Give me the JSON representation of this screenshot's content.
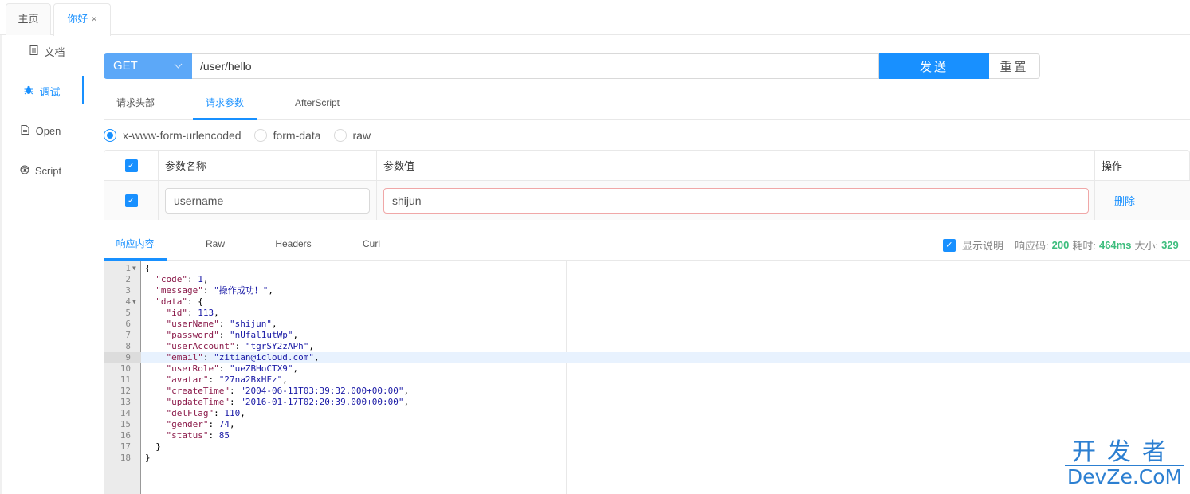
{
  "top_tabs": [
    {
      "label": "主页"
    },
    {
      "label": "你好",
      "close_icon": "×"
    }
  ],
  "left_nav": [
    {
      "label": "文档",
      "icon": "document-icon"
    },
    {
      "label": "调试",
      "icon": "bug-icon",
      "active": true
    },
    {
      "label": "Open",
      "icon": "file-icon"
    },
    {
      "label": "Script",
      "icon": "script-icon"
    }
  ],
  "url_bar": {
    "method": "GET",
    "url": "/user/hello",
    "send_label": "发送",
    "reset_label": "重置"
  },
  "request_tabs": [
    {
      "label": "请求头部"
    },
    {
      "label": "请求参数",
      "active": true
    },
    {
      "label": "AfterScript"
    }
  ],
  "body_types": [
    {
      "label": "x-www-form-urlencoded",
      "checked": true
    },
    {
      "label": "form-data"
    },
    {
      "label": "raw"
    }
  ],
  "params_table": {
    "headers": {
      "name": "参数名称",
      "value": "参数值",
      "op": "操作"
    },
    "rows": [
      {
        "checked": true,
        "name": "username",
        "value": "shijun",
        "action": "删除"
      }
    ]
  },
  "response_tabs": [
    {
      "label": "响应内容",
      "active": true
    },
    {
      "label": "Raw"
    },
    {
      "label": "Headers"
    },
    {
      "label": "Curl"
    }
  ],
  "response_info": {
    "show_desc_label": "显示说明",
    "show_desc_checked": true,
    "code_label": "响应码:",
    "code": "200",
    "time_label": "耗时:",
    "time": "464ms",
    "size_label": "大小:",
    "size": "329"
  },
  "editor": {
    "highlighted_line": 9,
    "lines": [
      {
        "no": "1",
        "fold": true
      },
      {
        "no": "2"
      },
      {
        "no": "3"
      },
      {
        "no": "4",
        "fold": true
      },
      {
        "no": "5"
      },
      {
        "no": "6"
      },
      {
        "no": "7"
      },
      {
        "no": "8"
      },
      {
        "no": "9"
      },
      {
        "no": "10"
      },
      {
        "no": "11"
      },
      {
        "no": "12"
      },
      {
        "no": "13"
      },
      {
        "no": "14"
      },
      {
        "no": "15"
      },
      {
        "no": "16"
      },
      {
        "no": "17"
      },
      {
        "no": "18"
      }
    ],
    "json": {
      "code": "1",
      "message": "\"操作成功！\"",
      "id": "113",
      "userName": "\"shijun\"",
      "password": "\"nUfal1utWp\"",
      "userAccount": "\"tgrSY2zAPh\"",
      "email": "\"zitian@icloud.com\"",
      "userRole": "\"ueZBHoCTX9\"",
      "avatar": "\"27na2BxHFz\"",
      "createTime": "\"2004-06-11T03:39:32.000+00:00\"",
      "updateTime": "\"2016-01-17T02:20:39.000+00:00\"",
      "delFlag": "110",
      "gender": "74",
      "status": "85"
    }
  },
  "watermark": {
    "cn": "开发者",
    "en": "DevZe.CoM"
  }
}
